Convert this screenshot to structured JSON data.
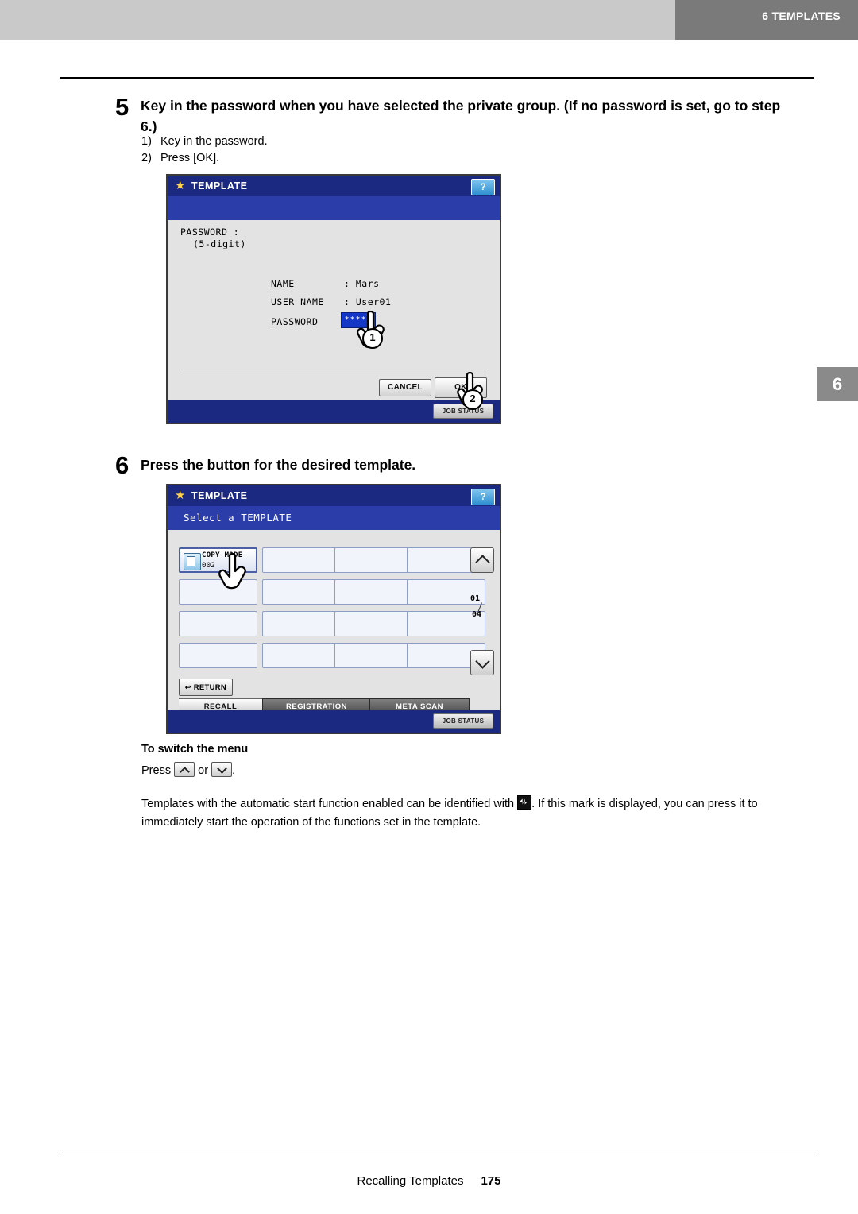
{
  "header": {
    "chapter_label": "6 TEMPLATES",
    "side_tab_number": "6"
  },
  "steps": [
    {
      "number": "5",
      "title": "Key in the password when you have selected the private group. (If no password is set, go to step 6.)",
      "substeps": [
        {
          "n": "1)",
          "text": "Key in the password."
        },
        {
          "n": "2)",
          "text": "Press [OK]."
        }
      ]
    },
    {
      "number": "6",
      "title": "Press the button for the desired template."
    }
  ],
  "panel_password": {
    "title": "TEMPLATE",
    "help_label": "?",
    "password_label": "PASSWORD :",
    "password_hint": "(5-digit)",
    "fields": [
      {
        "label": "NAME",
        "value": ": Mars"
      },
      {
        "label": "USER NAME",
        "value": ": User01"
      },
      {
        "label": "PASSWORD",
        "value": ""
      }
    ],
    "password_masked": "*****",
    "cancel_label": "CANCEL",
    "ok_label": "OK",
    "job_status_label": "JOB STATUS",
    "callout_1": "1",
    "callout_2": "2"
  },
  "panel_template": {
    "title": "TEMPLATE",
    "help_label": "?",
    "subtitle": "Select a TEMPLATE",
    "template_name": "COPY MODE",
    "template_number": "002",
    "page_current": "01",
    "page_total": "04",
    "return_label": "RETURN",
    "tabs": [
      {
        "label": "RECALL",
        "selected": true
      },
      {
        "label": "REGISTRATION",
        "selected": false
      },
      {
        "label": "META SCAN",
        "selected": false
      }
    ],
    "job_status_label": "JOB STATUS"
  },
  "switch_menu": {
    "heading": "To switch the menu",
    "press_prefix": "Press",
    "or_text": "or",
    "period": "."
  },
  "note": {
    "line1_before": "Templates with the automatic start function enabled can be identified with",
    "line1_after": ". If this mark is displayed, you can",
    "line2": "press it to immediately start the operation of the functions set in the template."
  },
  "footer": {
    "section": "Recalling Templates",
    "page": "175"
  }
}
